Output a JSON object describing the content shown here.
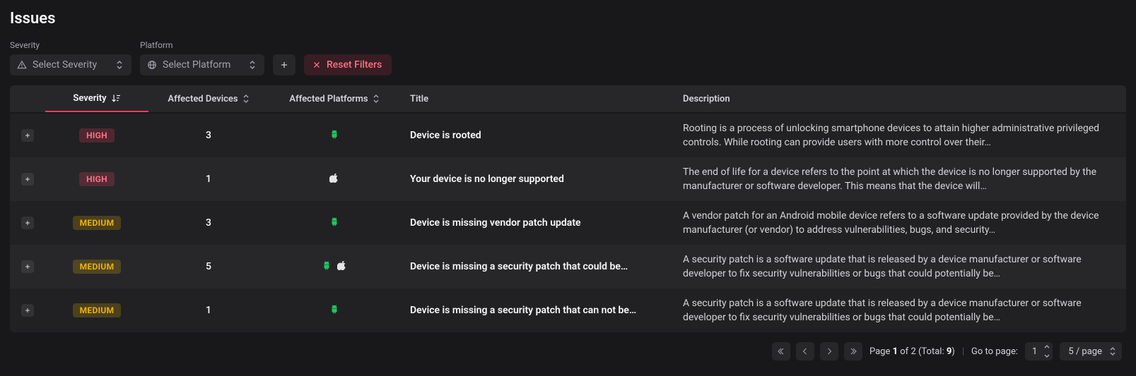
{
  "header": {
    "title": "Issues"
  },
  "filters": {
    "severity": {
      "label": "Severity",
      "placeholder": "Select Severity"
    },
    "platform": {
      "label": "Platform",
      "placeholder": "Select Platform"
    },
    "reset_label": "Reset Filters"
  },
  "columns": {
    "severity": "Severity",
    "affected_devices": "Affected Devices",
    "affected_platforms": "Affected Platforms",
    "title": "Title",
    "description": "Description"
  },
  "severity_levels": {
    "high": "HIGH",
    "medium": "MEDIUM"
  },
  "rows": [
    {
      "severity": "high",
      "devices": "3",
      "platforms": [
        "android"
      ],
      "title": "Device is rooted",
      "description": "Rooting is a process of unlocking smartphone devices to attain higher administrative privileged controls. While rooting can provide users with more control over their…"
    },
    {
      "severity": "high",
      "devices": "1",
      "platforms": [
        "apple"
      ],
      "title": "Your device is no longer supported",
      "description": "The end of life for a device refers to the point at which the device is no longer supported by the manufacturer or software developer. This means that the device will…"
    },
    {
      "severity": "medium",
      "devices": "3",
      "platforms": [
        "android"
      ],
      "title": "Device is missing vendor patch update",
      "description": "A vendor patch for an Android mobile device refers to a software update provided by the device manufacturer (or vendor) to address vulnerabilities, bugs, and security…"
    },
    {
      "severity": "medium",
      "devices": "5",
      "platforms": [
        "android",
        "apple"
      ],
      "title": "Device is missing a security patch that could be…",
      "description": "A security patch is a software update that is released by a device manufacturer or software developer to fix security vulnerabilities or bugs that could potentially be…"
    },
    {
      "severity": "medium",
      "devices": "1",
      "platforms": [
        "android"
      ],
      "title": "Device is missing a security patch that can not be…",
      "description": "A security patch is a software update that is released by a device manufacturer or software developer to fix security vulnerabilities or bugs that could potentially be…"
    }
  ],
  "pagination": {
    "page_label_prefix": "Page ",
    "page_current": "1",
    "page_label_mid": " of ",
    "page_total": "2",
    "total_prefix": " (Total: ",
    "total": "9",
    "total_suffix": ")",
    "goto_label": "Go to page:",
    "goto_value": "1",
    "pagesize_label": "5 / page"
  }
}
